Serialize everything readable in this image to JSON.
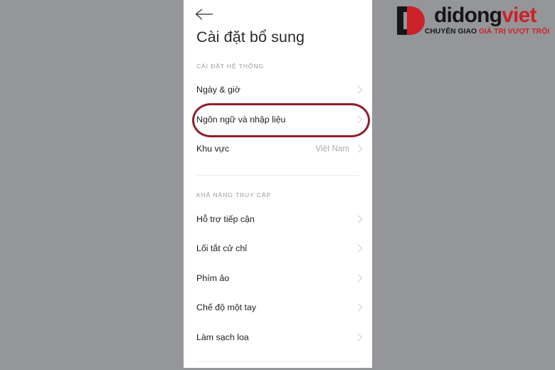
{
  "phone": {
    "back_icon": "arrow-left-icon",
    "title": "Cài đặt bổ sung",
    "sections": [
      {
        "label": "CÀI ĐẶT HỆ THỐNG",
        "items": [
          {
            "label": "Ngày & giờ",
            "value": "",
            "chevron": "chevron-right-icon"
          },
          {
            "label": "Ngôn ngữ và nhập liệu",
            "value": "",
            "chevron": "chevron-right-icon"
          },
          {
            "label": "Khu vực",
            "value": "Việt Nam",
            "chevron": "chevron-right-icon"
          }
        ]
      },
      {
        "label": "KHẢ NĂNG TRUY CẬP",
        "items": [
          {
            "label": "Hỗ trợ tiếp cận",
            "value": "",
            "chevron": "chevron-right-icon"
          },
          {
            "label": "Lối tắt cử chỉ",
            "value": "",
            "chevron": "chevron-right-icon"
          },
          {
            "label": "Phím ảo",
            "value": "",
            "chevron": "chevron-right-icon"
          },
          {
            "label": "Chế độ một tay",
            "value": "",
            "chevron": "chevron-right-icon"
          },
          {
            "label": "Làm sạch loa",
            "value": "",
            "chevron": "chevron-right-icon"
          }
        ]
      }
    ]
  },
  "annotation": {
    "highlight_target": "Ngôn ngữ và nhập liệu",
    "highlight_color": "#8e1f2f",
    "shape": "ellipse"
  },
  "watermark": {
    "brand_part1": "didong",
    "brand_part2": "viet",
    "tagline_part1": "CHUYỂN GIAO",
    "tagline_part2": "GIÁ TRỊ VƯỢT TRỘI",
    "mark_icon": "didongviet-logo-icon",
    "color_black": "#161616",
    "color_red": "#cc2229"
  },
  "colors": {
    "background": "#949699",
    "panel": "#ffffff",
    "divider": "#ececec",
    "section_label": "#9b9b9b",
    "row_label": "#1d1d1d",
    "row_value": "#a9a9a9"
  }
}
